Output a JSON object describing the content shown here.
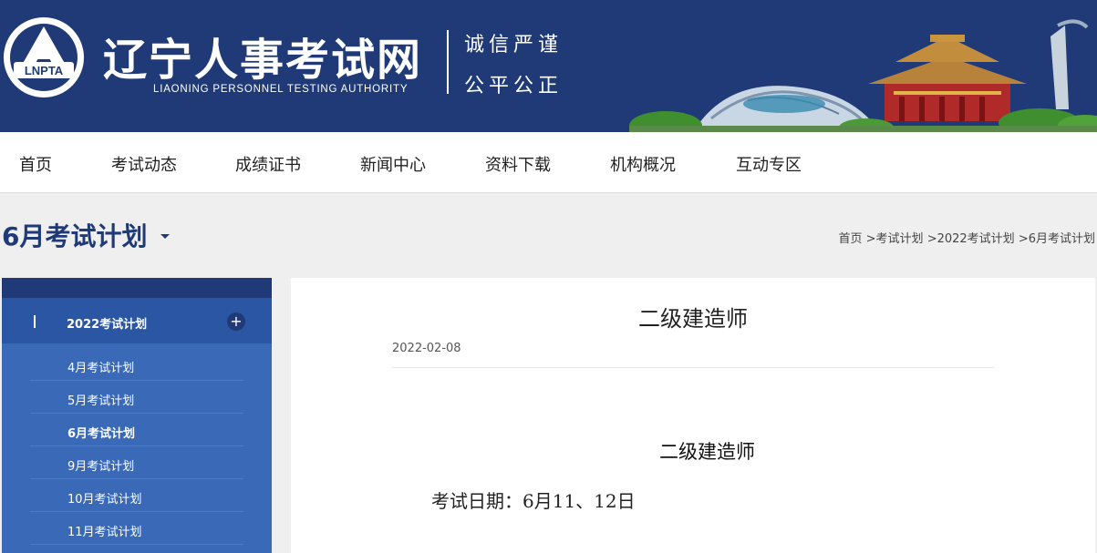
{
  "header": {
    "logo_text": "LNPTA",
    "title": "辽宁人事考试网",
    "subtitle": "LIAONING PERSONNEL TESTING AUTHORITY",
    "motto_line1": "诚信严谨",
    "motto_line2": "公平公正"
  },
  "nav": {
    "items": [
      {
        "label": "首页"
      },
      {
        "label": "考试动态"
      },
      {
        "label": "成绩证书"
      },
      {
        "label": "新闻中心"
      },
      {
        "label": "资料下载"
      },
      {
        "label": "机构概况"
      },
      {
        "label": "互动专区"
      }
    ]
  },
  "page": {
    "heading": "6月考试计划",
    "breadcrumb": [
      "首页",
      ">考试计划",
      ">2022考试计划",
      ">6月考试计划"
    ]
  },
  "sidebar": {
    "group_label": "2022考试计划",
    "group_toggle": "+",
    "items": [
      {
        "label": "4月考试计划"
      },
      {
        "label": "5月考试计划"
      },
      {
        "label": "6月考试计划"
      },
      {
        "label": "9月考试计划"
      },
      {
        "label": "10月考试计划"
      },
      {
        "label": "11月考试计划"
      }
    ],
    "active_item": "6月考试计划"
  },
  "article": {
    "title": "二级建造师",
    "date": "2022-02-08",
    "body_heading": "二级建造师",
    "body_line": "考试日期：6月11、12日"
  },
  "colors": {
    "header_bg": "#1f3a76",
    "sidebar_bg": "#3969b7",
    "sidebar_group_bg": "#2b56a3",
    "page_bg": "#efefef"
  }
}
